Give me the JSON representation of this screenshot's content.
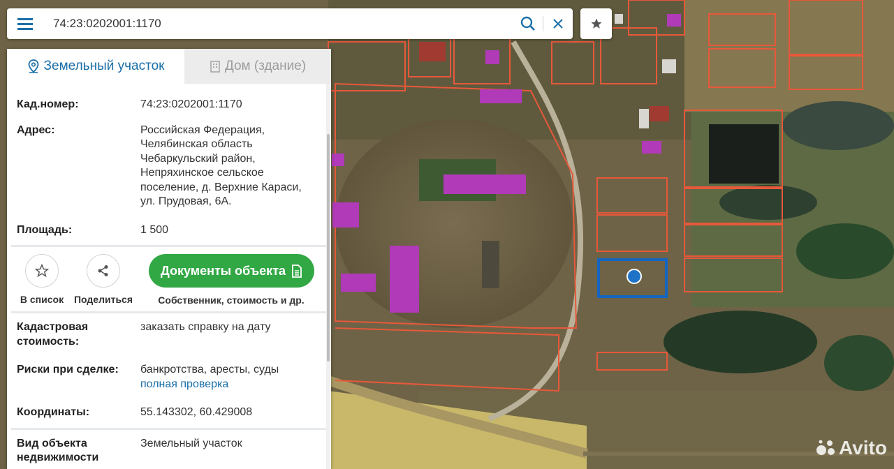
{
  "search": {
    "query": "74:23:0202001:1170"
  },
  "tabs": [
    {
      "label": "Земельный участок",
      "icon": "map-pin-icon"
    },
    {
      "label": "Дом (здание)",
      "icon": "building-icon"
    }
  ],
  "info": {
    "cad_number": {
      "label": "Кад.номер:",
      "value": "74:23:0202001:1170"
    },
    "address": {
      "label": "Адрес:",
      "value": "Российская Федерация, Челябинская область Чебаркульский район, Непряхинское сельское поселение, д. Верхние Караси, ул. Прудовая, 6А."
    },
    "area": {
      "label": "Площадь:",
      "value": "1 500"
    },
    "cadastral_value": {
      "label": "Кадастровая стоимость:",
      "link": "заказать справку на дату"
    },
    "risks": {
      "label": "Риски при сделке:",
      "value": "банкротства, аресты, суды",
      "link": "полная проверка"
    },
    "coordinates": {
      "label": "Координаты:",
      "value": "55.143302, 60.429008"
    },
    "object_type": {
      "label": "Вид объекта недвижимости",
      "value": "Земельный участок"
    }
  },
  "actions": {
    "add_to_list": "В список",
    "share": "Поделиться",
    "documents_button": "Документы объекта",
    "documents_sub": "Собственник, стоимость и др."
  },
  "watermark": "Avito",
  "colors": {
    "accent_blue": "#1b6fa8",
    "green_button": "#32a845",
    "parcel_border": "#e8583a",
    "building_roof": "#b03ab8",
    "selected_parcel": "#1565c0"
  }
}
